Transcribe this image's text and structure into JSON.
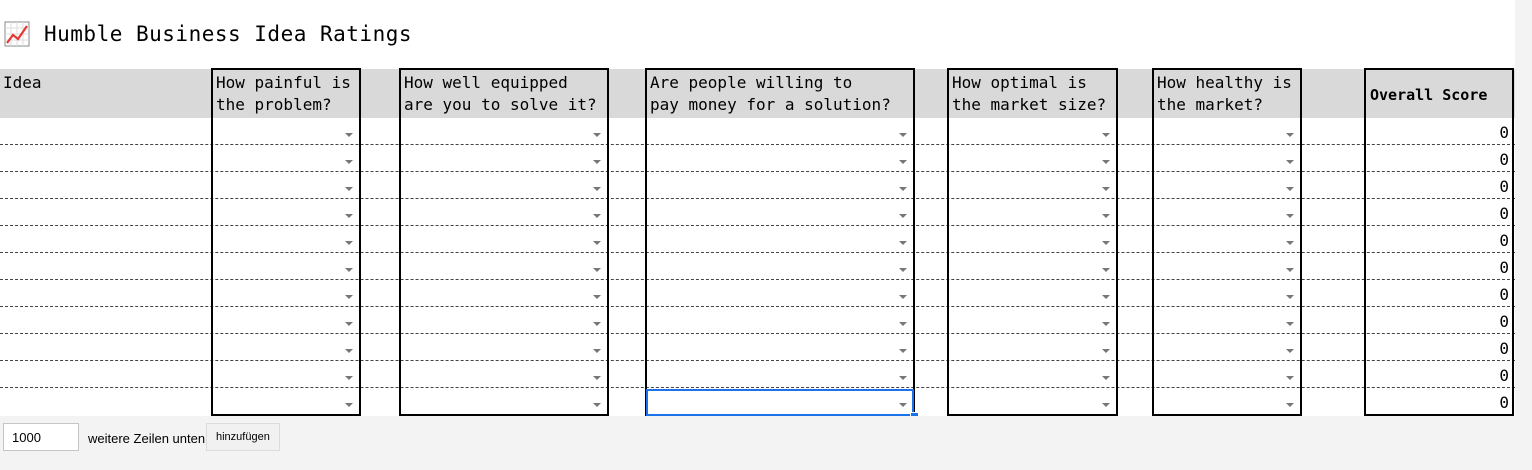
{
  "title": {
    "icon": "chart-increasing-icon",
    "text": "Humble Business Idea Ratings"
  },
  "headers": {
    "idea": "Idea",
    "painful": "How painful is\nthe problem?",
    "equipped": "How well equipped\nare you to solve it?",
    "pay": "Are people willing to\npay money for a solution?",
    "market_size": "How optimal is\nthe market size?",
    "market_health": "How healthy is\nthe market?",
    "overall": "Overall Score"
  },
  "scores": [
    "0",
    "0",
    "0",
    "0",
    "0",
    "0",
    "0",
    "0",
    "0",
    "0",
    "0"
  ],
  "footer": {
    "rows_value": "1000",
    "rows_label": "weitere Zeilen unten",
    "add_button": "hinzufügen"
  },
  "colors": {
    "header_bg": "#d9d9d9",
    "selection": "#1a73e8"
  }
}
